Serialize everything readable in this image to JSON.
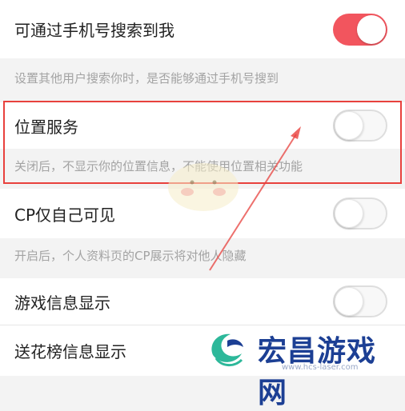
{
  "settings": [
    {
      "label": "可通过手机号搜索到我",
      "on": true,
      "description": "设置其他用户搜索你时，是否能够通过手机号搜到"
    },
    {
      "label": "位置服务",
      "on": false,
      "description": "关闭后，不显示你的位置信息，不能使用位置相关功能"
    },
    {
      "label": "CP仅自己可见",
      "on": false,
      "description": "开启后，个人资料页的CP展示将对他人隐藏"
    },
    {
      "label": "游戏信息显示",
      "on": false
    },
    {
      "label": "送花榜信息显示",
      "on": false
    }
  ],
  "watermark": {
    "name": "宏昌游戏网",
    "url": "www.hcs-laser.com"
  },
  "colors": {
    "toggle_on": "#f2555e",
    "highlight_border": "#e8413d",
    "watermark": "#1c3f94"
  }
}
